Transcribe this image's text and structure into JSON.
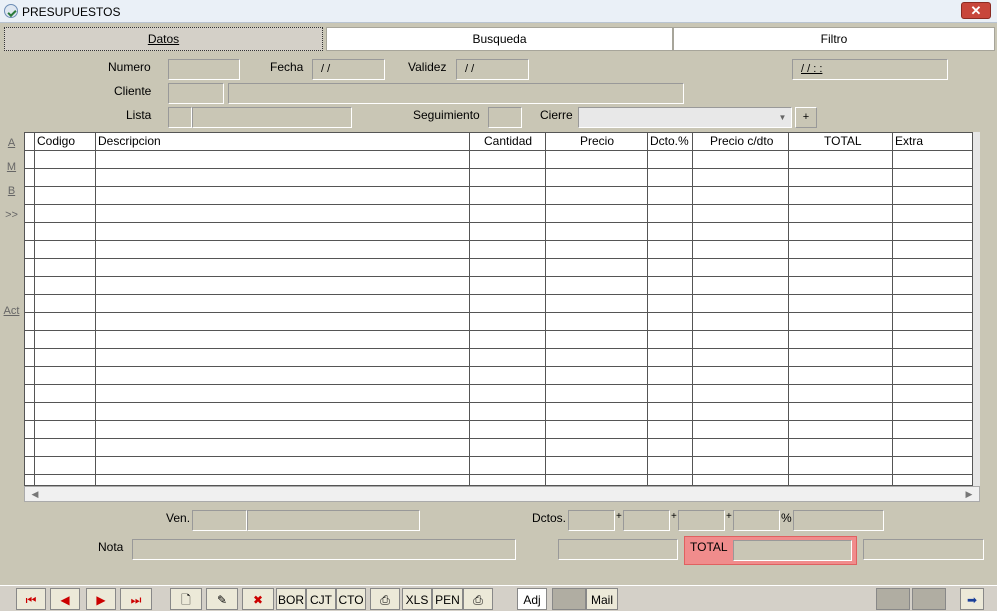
{
  "window": {
    "title": "PRESUPUESTOS",
    "close_label": "✕"
  },
  "tabs": [
    {
      "label": "Datos"
    },
    {
      "label": "Busqueda"
    },
    {
      "label": "Filtro"
    }
  ],
  "form": {
    "numero_label": "Numero",
    "numero_value": "",
    "fecha_label": "Fecha",
    "fecha_value": "/ /",
    "validez_label": "Validez",
    "validez_value": "/ /",
    "datetime_value": "/ /    :  :",
    "cliente_label": "Cliente",
    "lista_label": "Lista",
    "seguimiento_label": "Seguimiento",
    "cierre_label": "Cierre",
    "plus_label": "+"
  },
  "side_buttons": {
    "a": "A",
    "m": "M",
    "b": "B",
    "more": ">>",
    "act": "Act"
  },
  "grid": {
    "columns": [
      "Codigo",
      "Descripcion",
      "Cantidad",
      "Precio",
      "Dcto.%",
      "Precio c/dto",
      "TOTAL",
      "Extra"
    ]
  },
  "footer": {
    "ven_label": "Ven.",
    "nota_label": "Nota",
    "dctos_label": "Dctos.",
    "plus1": "+",
    "plus2": "+",
    "plus3": "+",
    "percent": "%",
    "total_label": "TOTAL"
  },
  "toolbar": {
    "bor": "BOR",
    "cjt": "CJT",
    "cto": "CTO",
    "xls": "XLS",
    "pen": "PEN",
    "adj": "Adj",
    "mail": "Mail"
  },
  "colors": {
    "accent_total": "#f08c8c",
    "background": "#c9c6b5"
  }
}
